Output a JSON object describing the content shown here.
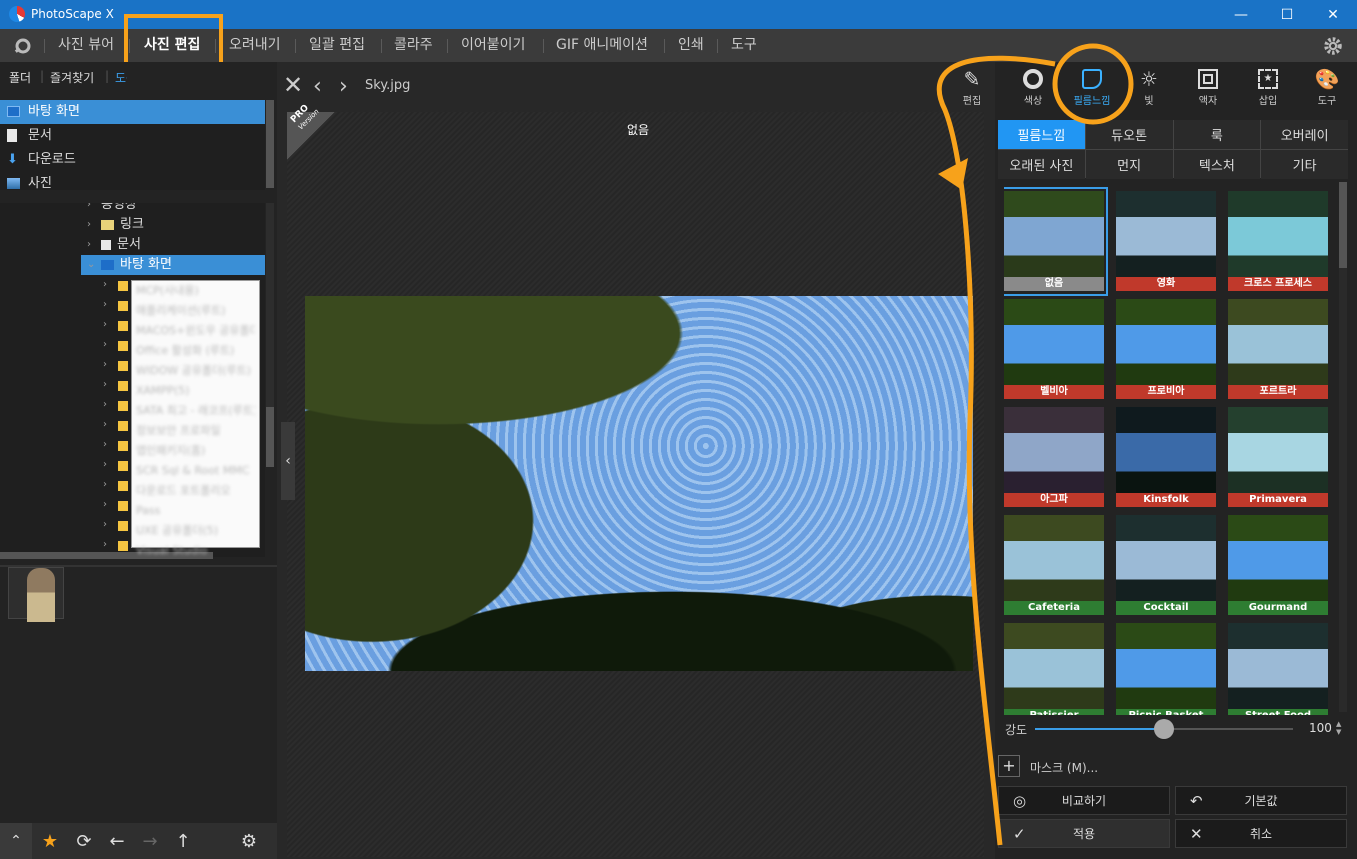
{
  "window": {
    "title": "PhotoScape X",
    "minimize": "—",
    "maximize": "☐",
    "close": "✕"
  },
  "menu": {
    "items": [
      "사진 뷰어",
      "사진 편집",
      "오려내기",
      "일괄 편집",
      "콜라주",
      "이어붙이기",
      "GIF 애니메이션",
      "인쇄",
      "도구"
    ],
    "active": "사진 편집"
  },
  "left": {
    "tabs": [
      "폴더",
      "즐겨찾기",
      "도구"
    ],
    "quick_access": [
      "바탕 화면",
      "문서",
      "다운로드",
      "사진"
    ],
    "tree": {
      "partial_top": "동영상",
      "items": [
        "링크",
        "문서",
        "바탕 화면"
      ],
      "selected": "바탕 화면"
    },
    "popup_items": [
      "MCP(사내용)",
      "애플리케이션(루트)",
      "MACOS+윈도우 공유폴더(",
      "Office 활성화 (루트)",
      "WIDOW 공유폴더(루트)",
      "XAMPP(5)",
      "SATA 최고 - 래코프(루트)",
      "정보보안 프로파일",
      "앱인패키지(홈)",
      "SCR Sql & Root MMC",
      "다운로드 포트폴리오",
      "Pass",
      "UXE 공유폴더(5)",
      "Visual Studio"
    ],
    "bottom_icons": [
      "up-icon",
      "star-icon",
      "refresh-icon",
      "back-icon",
      "forward-icon",
      "up-arrow-icon",
      "settings-icon"
    ]
  },
  "viewer": {
    "filename": "Sky.jpg",
    "current_filter": "없음",
    "pro_badge": "PRO",
    "pro_badge_sub": "Version"
  },
  "tools": [
    {
      "label": "편집",
      "icon": "edit-icon"
    },
    {
      "label": "색상",
      "icon": "color-circle-icon"
    },
    {
      "label": "필름느낌",
      "icon": "film-icon",
      "active": true
    },
    {
      "label": "빛",
      "icon": "sun-icon"
    },
    {
      "label": "액자",
      "icon": "frame-icon"
    },
    {
      "label": "삽입",
      "icon": "insert-icon"
    },
    {
      "label": "도구",
      "icon": "palette-icon"
    }
  ],
  "filter_tabs": [
    "필름느낌",
    "듀오톤",
    "룩",
    "오버레이",
    "오래된 사진",
    "먼지",
    "텍스처",
    "기타"
  ],
  "filter_tab_selected": "필름느낌",
  "filters": [
    {
      "name": "없음",
      "color": "#8a8a8a",
      "tint": "none"
    },
    {
      "name": "영화",
      "color": "#c0392b",
      "tint": "cool"
    },
    {
      "name": "크로스 프로세스",
      "color": "#c0392b",
      "tint": "teal"
    },
    {
      "name": "벨비아",
      "color": "#c0392b",
      "tint": "vivid"
    },
    {
      "name": "프로비아",
      "color": "#c0392b",
      "tint": "vivid"
    },
    {
      "name": "포르트라",
      "color": "#c0392b",
      "tint": "warm"
    },
    {
      "name": "아그파",
      "color": "#c0392b",
      "tint": "purple"
    },
    {
      "name": "Kinsfolk",
      "color": "#c0392b",
      "tint": "dark"
    },
    {
      "name": "Primavera",
      "color": "#c0392b",
      "tint": "cyan"
    },
    {
      "name": "Cafeteria",
      "color": "#2e7d32",
      "tint": "warm"
    },
    {
      "name": "Cocktail",
      "color": "#2e7d32",
      "tint": "cool"
    },
    {
      "name": "Gourmand",
      "color": "#2e7d32",
      "tint": "vivid"
    },
    {
      "name": "Patissier",
      "color": "#2e7d32",
      "tint": "warm"
    },
    {
      "name": "Picnic Basket",
      "color": "#2e7d32",
      "tint": "vivid"
    },
    {
      "name": "Street Food",
      "color": "#2e7d32",
      "tint": "cool"
    }
  ],
  "strength": {
    "label": "강도",
    "value": "100",
    "fraction": 0.5
  },
  "mask_label": "마스크 (M)...",
  "buttons": {
    "compare": "비교하기",
    "reset": "기본값",
    "apply": "적용",
    "cancel": "취소"
  },
  "colors": {
    "accent": "#3a9de8",
    "highlight": "#f7a21b",
    "titlebar": "#1a73c6"
  }
}
